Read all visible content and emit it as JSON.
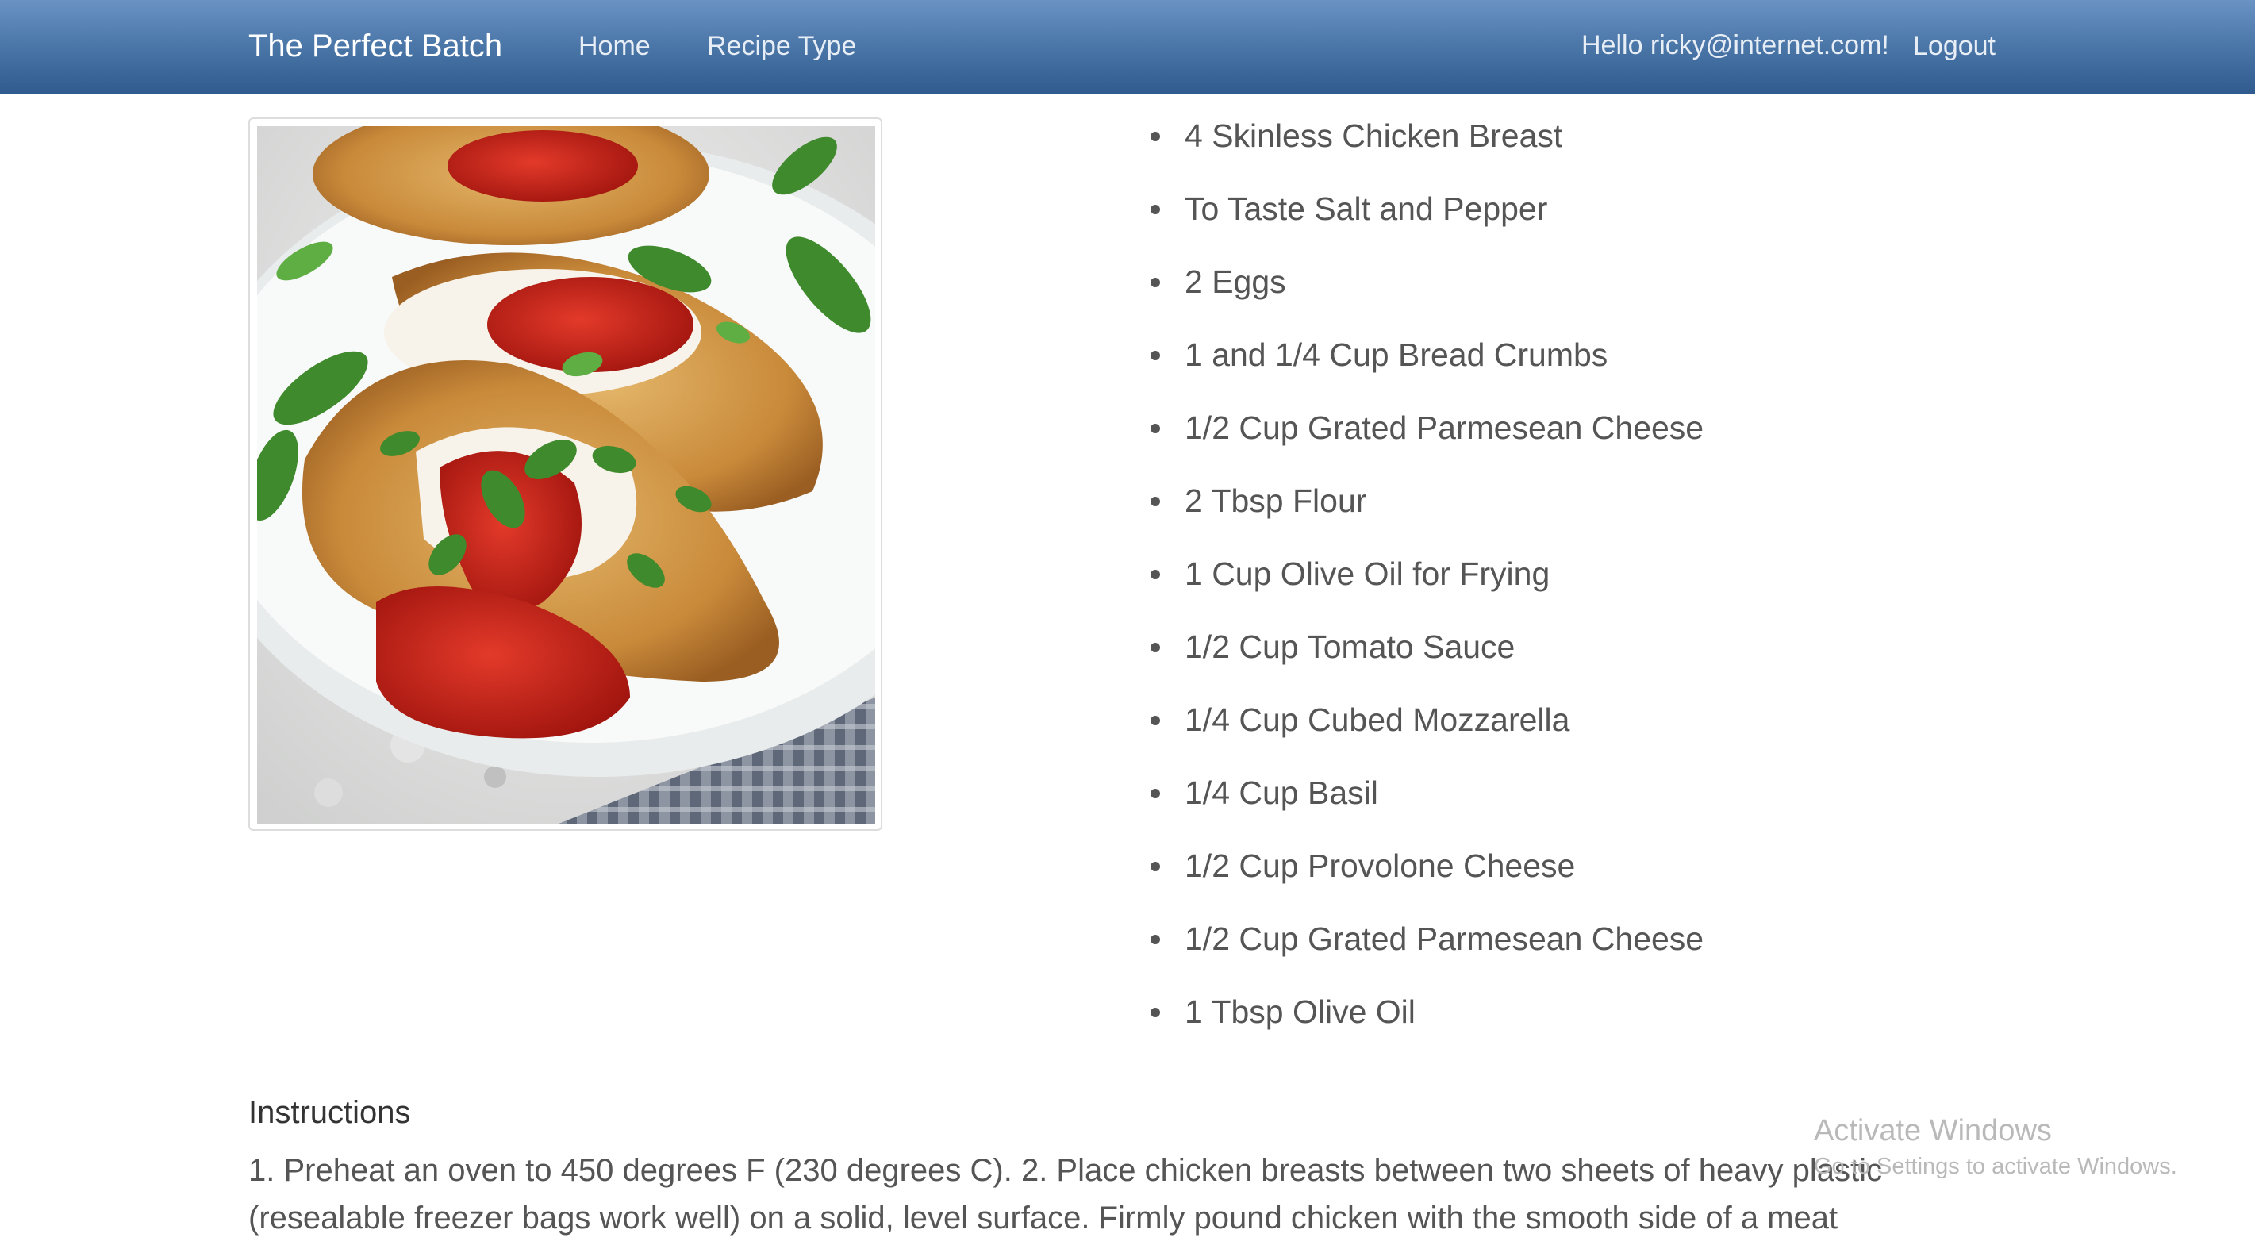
{
  "nav": {
    "brand": "The Perfect Batch",
    "home": "Home",
    "recipe_type": "Recipe Type",
    "greeting": "Hello ricky@internet.com!",
    "logout": "Logout"
  },
  "recipe": {
    "image_icon": "chicken-parmesan-photo",
    "ingredients": [
      "4 Skinless Chicken Breast",
      "To Taste Salt and Pepper",
      "2 Eggs",
      "1 and 1/4 Cup Bread Crumbs",
      "1/2 Cup Grated Parmesean Cheese",
      "2 Tbsp Flour",
      "1 Cup Olive Oil for Frying",
      "1/2 Cup Tomato Sauce",
      "1/4 Cup Cubed Mozzarella",
      "1/4 Cup Basil",
      "1/2 Cup Provolone Cheese",
      "1/2 Cup Grated Parmesean Cheese",
      "1 Tbsp Olive Oil"
    ],
    "instructions_title": "Instructions",
    "instructions_text": "1. Preheat an oven to 450 degrees F (230 degrees C). 2. Place chicken breasts between two sheets of heavy plastic (resealable freezer bags work well) on a solid, level surface. Firmly pound chicken with the smooth side of a meat"
  },
  "watermark": {
    "line1": "Activate Windows",
    "line2": "Go to Settings to activate Windows."
  },
  "colors": {
    "navbar_top": "#6a93c4",
    "navbar_bottom": "#2f5b8e",
    "text": "#555555"
  }
}
